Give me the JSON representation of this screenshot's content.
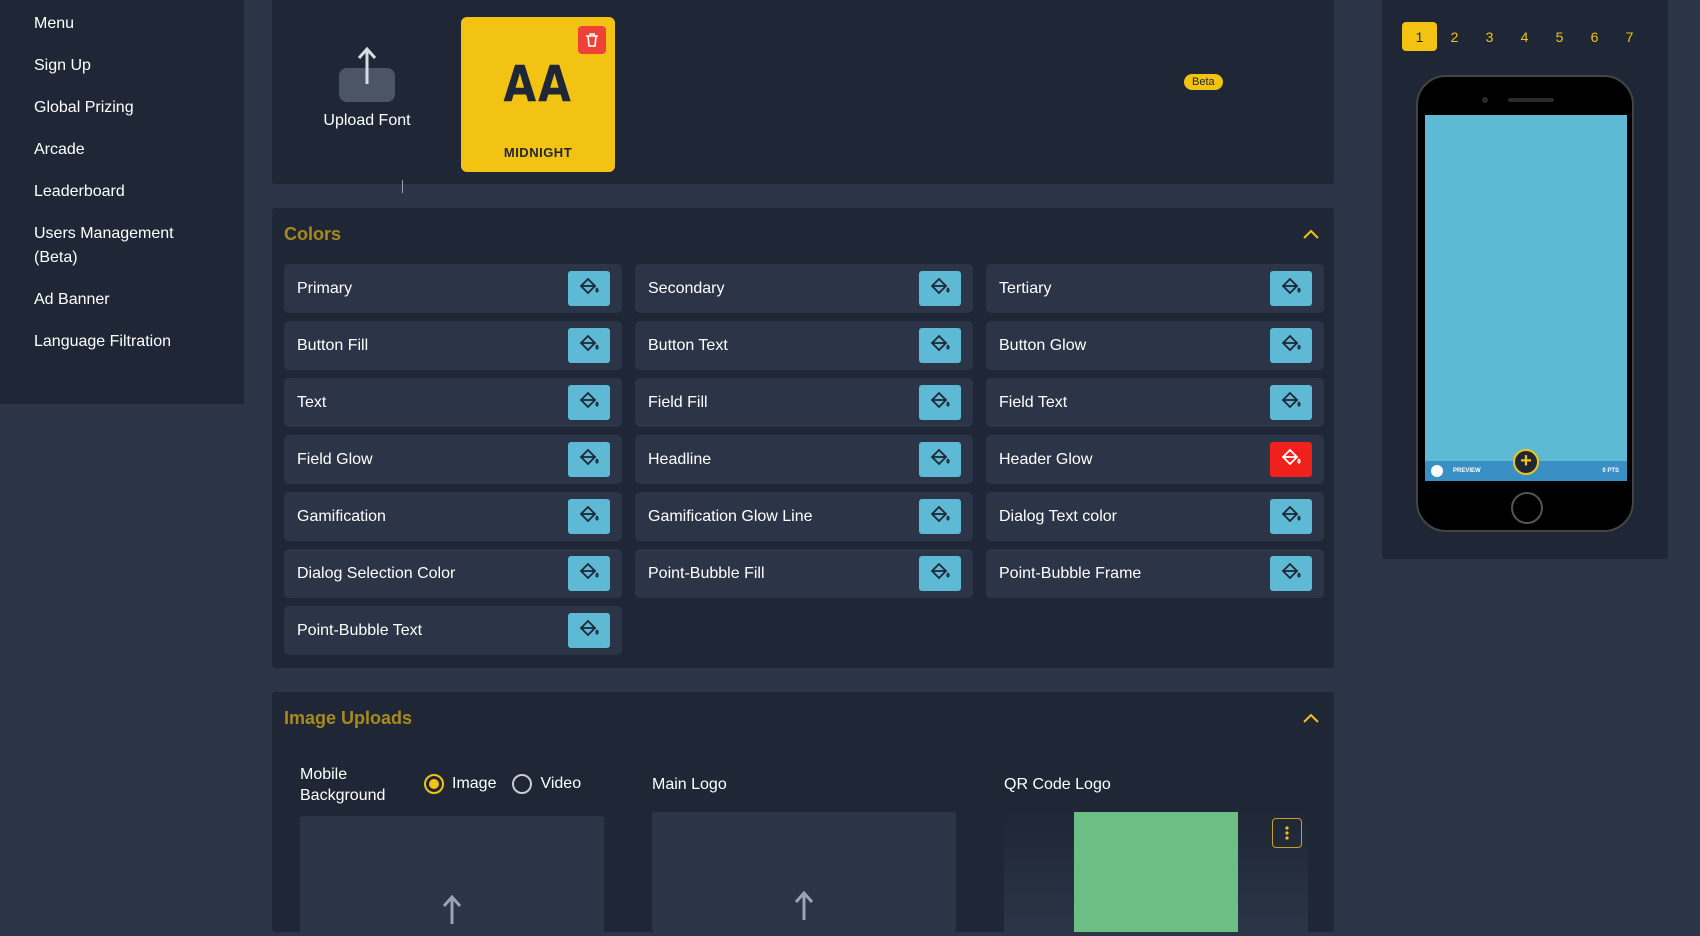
{
  "sidebar": {
    "items": [
      {
        "label": "Menu"
      },
      {
        "label": "Sign Up"
      },
      {
        "label": "Global Prizing"
      },
      {
        "label": "Arcade"
      },
      {
        "label": "Leaderboard"
      },
      {
        "label": "Users Management (Beta)"
      },
      {
        "label": "Ad Banner"
      },
      {
        "label": "Language Filtration"
      }
    ]
  },
  "fonts": {
    "upload_label": "Upload Font",
    "card_sample": "AA",
    "card_name": "MIDNIGHT",
    "beta_badge": "Beta"
  },
  "colors": {
    "title": "Colors",
    "items": [
      {
        "label": "Primary"
      },
      {
        "label": "Secondary"
      },
      {
        "label": "Tertiary"
      },
      {
        "label": "Button Fill"
      },
      {
        "label": "Button Text"
      },
      {
        "label": "Button Glow"
      },
      {
        "label": "Text"
      },
      {
        "label": "Field Fill"
      },
      {
        "label": "Field Text"
      },
      {
        "label": "Field Glow"
      },
      {
        "label": "Headline"
      },
      {
        "label": "Header Glow",
        "alert": true
      },
      {
        "label": "Gamification"
      },
      {
        "label": "Gamification Glow Line"
      },
      {
        "label": "Dialog Text color"
      },
      {
        "label": "Dialog Selection Color"
      },
      {
        "label": "Point-Bubble Fill"
      },
      {
        "label": "Point-Bubble Frame"
      },
      {
        "label": "Point-Bubble Text"
      }
    ]
  },
  "image_uploads": {
    "title": "Image Uploads",
    "mobile_background": "Mobile Background",
    "radio_image": "Image",
    "radio_video": "Video",
    "main_logo": "Main Logo",
    "qr_code_logo": "QR Code Logo"
  },
  "preview": {
    "pages": [
      "1",
      "2",
      "3",
      "4",
      "5",
      "6",
      "7"
    ],
    "active_page": "1",
    "bar_left": "PREVIEW",
    "bar_right": "0 PTS",
    "plus": "+"
  },
  "theme": {
    "accent": "#f2c312",
    "color_button": "#5eb9d4",
    "alert_button": "#f0201c",
    "panel": "#1f2736",
    "background": "#2b3547"
  }
}
